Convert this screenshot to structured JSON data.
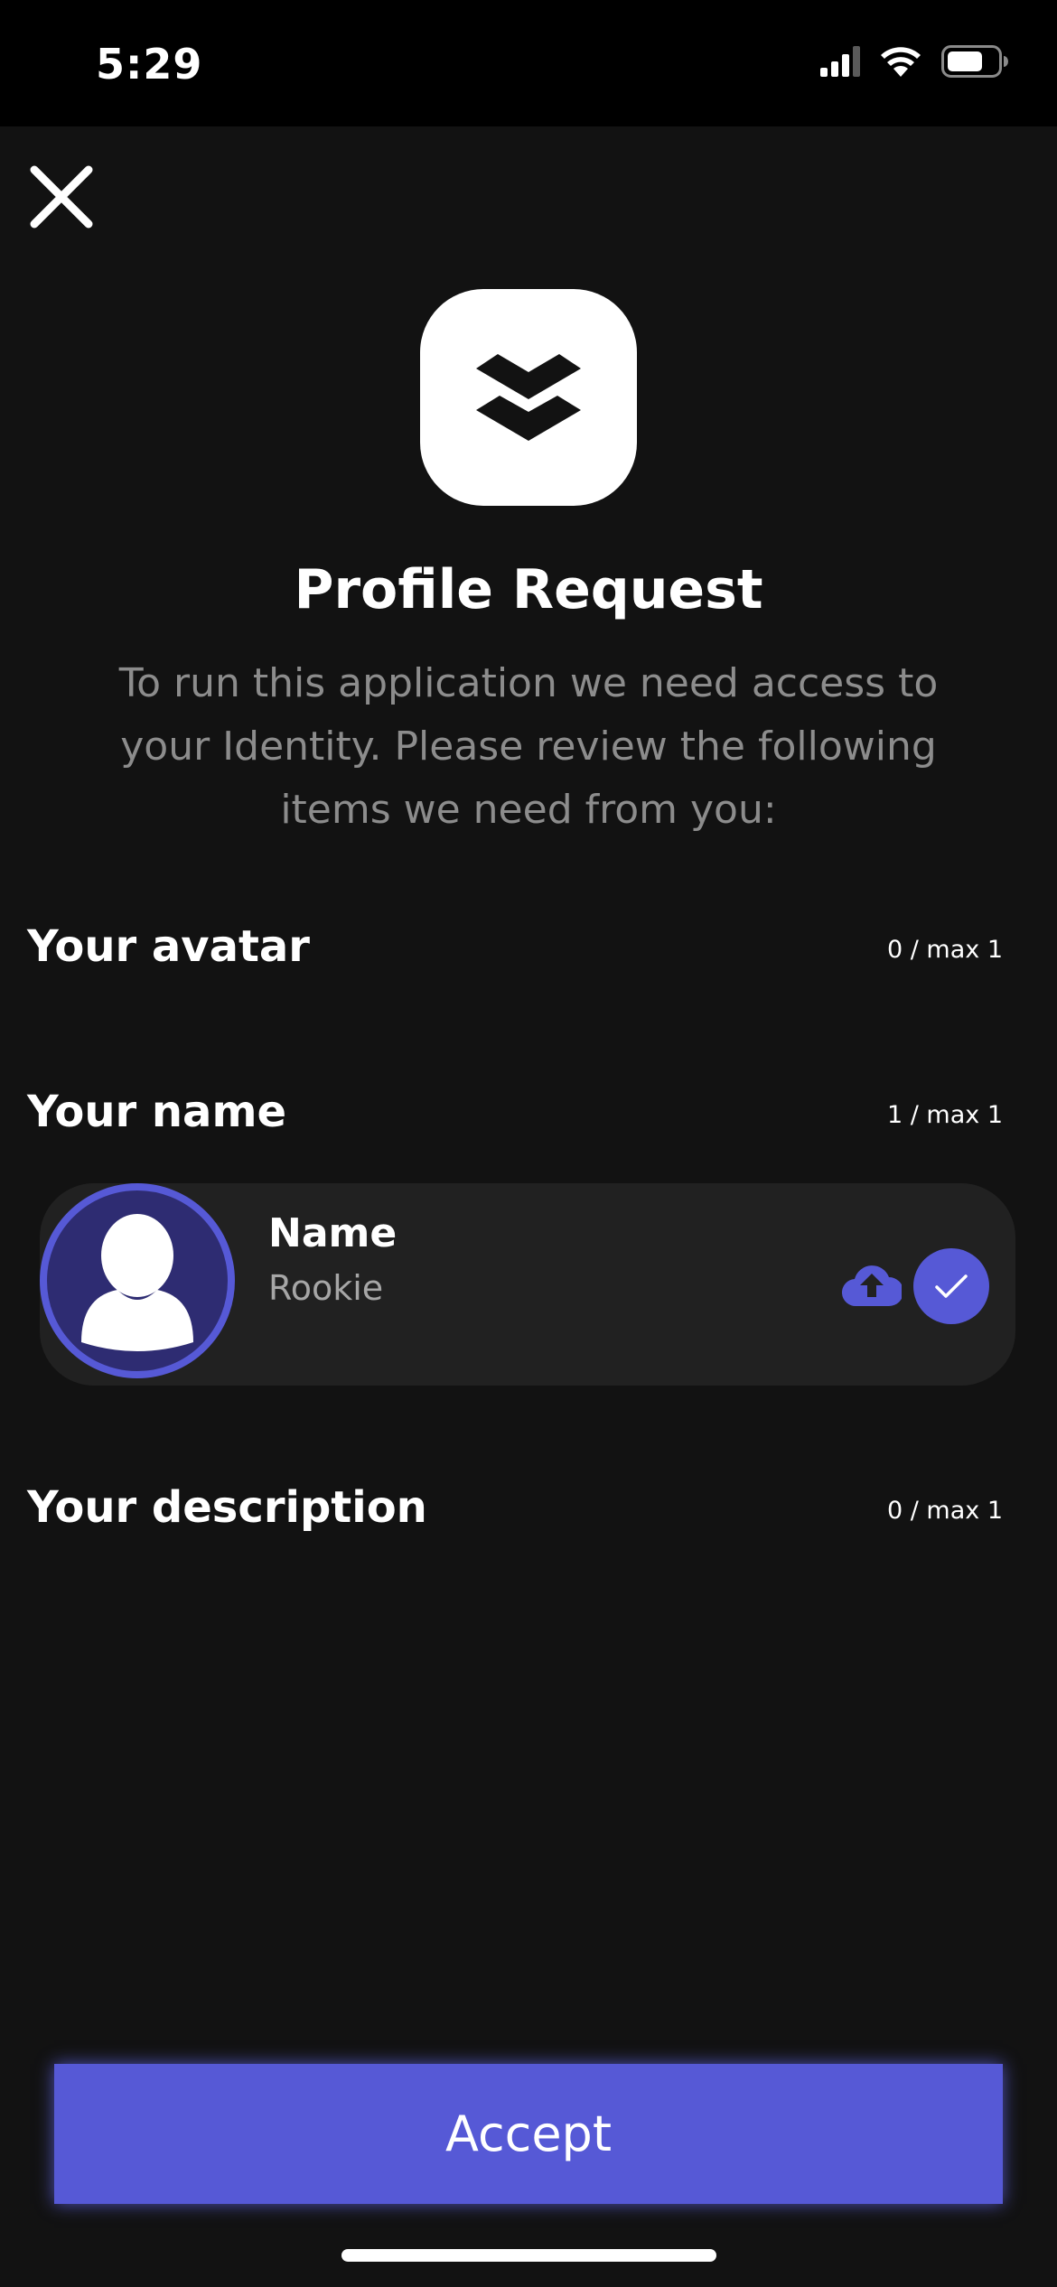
{
  "status_bar": {
    "time": "5:29",
    "icons": [
      "cellular-signal-icon",
      "wifi-icon",
      "battery-icon"
    ]
  },
  "header": {
    "close_icon": "close-icon",
    "logo_icon": "layers-logo-icon"
  },
  "title": "Profile Request",
  "subtitle": "To run this application we need access to your Identity. Please review the following items we need from you:",
  "sections": {
    "avatar": {
      "heading": "Your avatar",
      "count": "0 / max 1"
    },
    "name": {
      "heading": "Your name",
      "count": "1 / max 1",
      "card": {
        "label": "Name",
        "value": "Rookie",
        "avatar_icon": "user-silhouette-icon",
        "upload_icon": "cloud-upload-icon",
        "selected_icon": "checkmark-icon"
      }
    },
    "description": {
      "heading": "Your description",
      "count": "0 / max 1"
    }
  },
  "actions": {
    "accept_label": "Accept"
  },
  "colors": {
    "background": "#121212",
    "status_bar": "#000000",
    "card": "#212121",
    "accent": "#5659d6",
    "avatar_fill": "#2e2c72",
    "subtitle_text": "#8c8c8c"
  }
}
